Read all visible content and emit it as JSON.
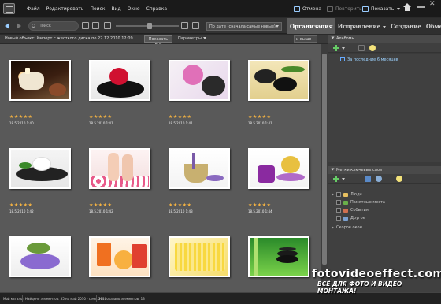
{
  "menu": {
    "items": [
      "Файл",
      "Редактировать",
      "Поиск",
      "Вид",
      "Окно",
      "Справка"
    ],
    "undo": "Отмена",
    "redo": "Повторить",
    "show": "Показать"
  },
  "toolbar": {
    "search_placeholder": "Поиск",
    "sort_value": "По дате (сначала самые новые)"
  },
  "tabs": [
    {
      "label": "Организация",
      "active": true
    },
    {
      "label": "Исправление",
      "active": false
    },
    {
      "label": "Создание",
      "active": false
    },
    {
      "label": "Обмен",
      "active": false
    }
  ],
  "grid_header": {
    "title": "Новый объект: Импорт с жесткого диска по 22.12.2010 12:09",
    "show_all": "Показать все",
    "params": "Параметры",
    "rating_filter": "и выше"
  },
  "photos": [
    {
      "date": "18.5.2010 1:40",
      "rating": 5,
      "thumb": "candles"
    },
    {
      "date": "18.5.2010 1:41",
      "rating": 5,
      "thumb": "rose"
    },
    {
      "date": "18.5.2010 1:41",
      "rating": 5,
      "thumb": "orchid"
    },
    {
      "date": "18.5.2010 1:41",
      "rating": 5,
      "thumb": "stones"
    },
    {
      "date": "18.5.2010 1:42",
      "rating": 5,
      "thumb": "lily"
    },
    {
      "date": "18.5.2010 1:42",
      "rating": 5,
      "thumb": "feet"
    },
    {
      "date": "18.5.2010 1:43",
      "rating": 5,
      "thumb": "lavender"
    },
    {
      "date": "18.5.2010 1:44",
      "rating": 5,
      "thumb": "salt"
    },
    {
      "date": "",
      "rating": 0,
      "thumb": "purple"
    },
    {
      "date": "",
      "rating": 0,
      "thumb": "orange"
    },
    {
      "date": "",
      "rating": 0,
      "thumb": "yellow"
    },
    {
      "date": "",
      "rating": 0,
      "thumb": "green"
    }
  ],
  "albums": {
    "title": "Альбомы",
    "items": [
      "За последние 6 месяцев"
    ]
  },
  "tags": {
    "title": "Метки ключевых слов",
    "items": [
      {
        "label": "Люди",
        "color": "#e8c060"
      },
      {
        "label": "Памятные места",
        "color": "#6ab04a"
      },
      {
        "label": "События",
        "color": "#d07050"
      },
      {
        "label": "Другое",
        "color": "#7aa0d0"
      }
    ],
    "hidden_label": "Скорое окон"
  },
  "status": {
    "catalog": "Мой каталог",
    "found": "Найдено элементов: 35 на май 2010 - сент. 2010",
    "not_shown": "Не показано элементов: 13"
  },
  "watermark": {
    "site": "fotovideoeffect.com",
    "slogan": "ВСЁ ДЛЯ ФОТО И ВИДЕО МОНТАЖА!"
  }
}
